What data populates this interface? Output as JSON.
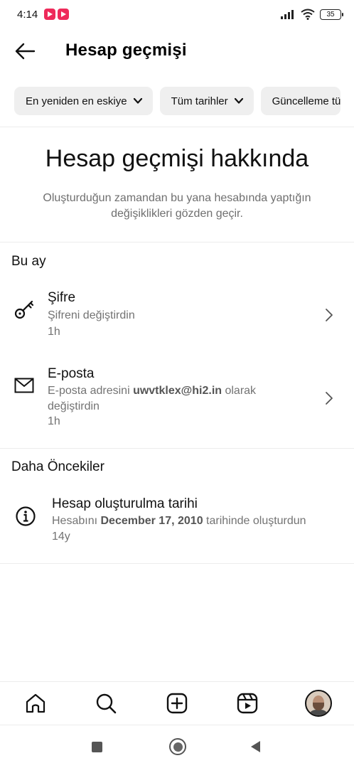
{
  "status_bar": {
    "time": "4:14",
    "battery": "35"
  },
  "header": {
    "title": "Hesap geçmişi"
  },
  "filters": [
    {
      "label": "En yeniden en eskiye"
    },
    {
      "label": "Tüm tarihler"
    },
    {
      "label": "Güncelleme tü"
    }
  ],
  "about": {
    "title": "Hesap geçmişi hakkında",
    "description": "Oluşturduğun zamandan bu yana hesabında yaptığın değişiklikleri gözden geçir."
  },
  "this_month": {
    "title": "Bu ay",
    "items": [
      {
        "icon": "key-icon",
        "title": "Şifre",
        "subtitle": "Şifreni değiştirdin",
        "time": "1h"
      },
      {
        "icon": "mail-icon",
        "title": "E-posta",
        "subtitle_prefix": "E-posta adresini ",
        "subtitle_bold": "uwvtklex@hi2.in",
        "subtitle_suffix": " olarak",
        "subtitle_line2": "değiştirdin",
        "time": "1h"
      }
    ]
  },
  "earlier": {
    "title": "Daha Öncekiler",
    "items": [
      {
        "icon": "info-icon",
        "title": "Hesap oluşturulma tarihi",
        "subtitle_prefix": "Hesabını ",
        "subtitle_bold": "December 17, 2010",
        "subtitle_suffix": " tarihinde oluşturdun",
        "time": "14y"
      }
    ]
  },
  "bottom_nav": [
    "home-icon",
    "search-icon",
    "create-icon",
    "reels-icon",
    "profile-avatar"
  ],
  "system_nav": [
    "recents-button",
    "home-button",
    "back-button"
  ]
}
